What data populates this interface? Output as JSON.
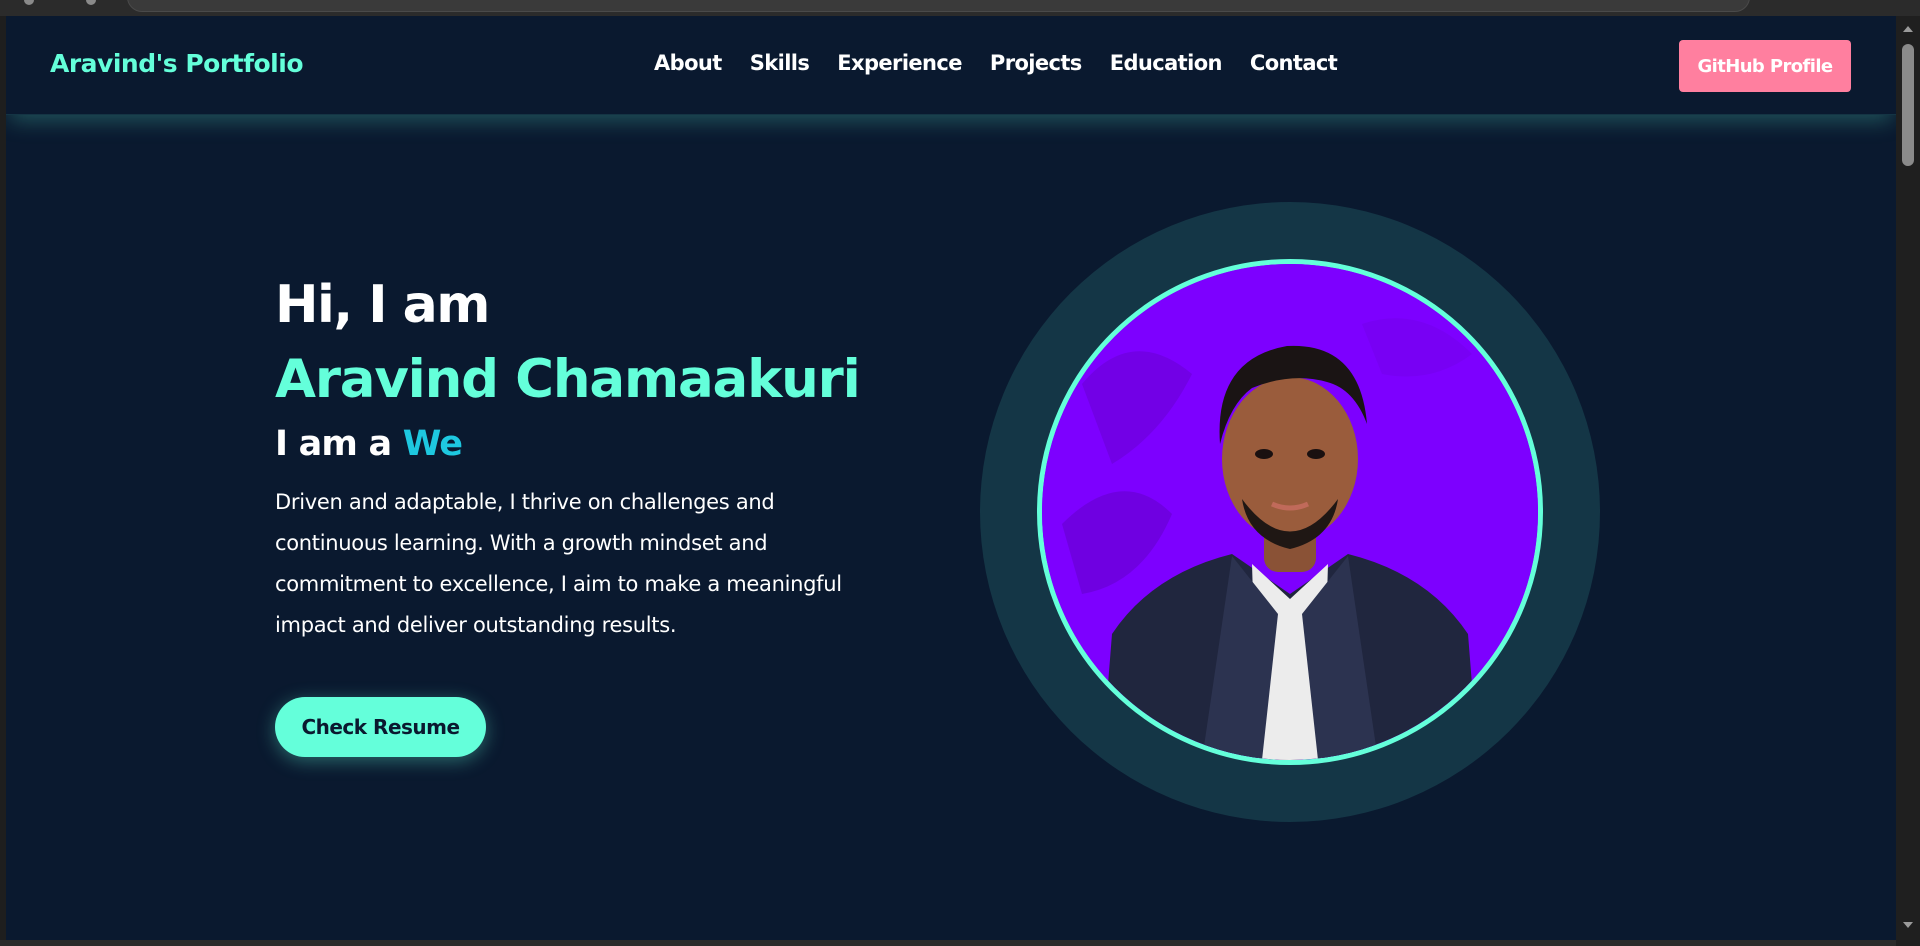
{
  "nav": {
    "logo": "Aravind's Portfolio",
    "links": [
      "About",
      "Skills",
      "Experience",
      "Projects",
      "Education",
      "Contact"
    ],
    "github_label": "GitHub Profile"
  },
  "hero": {
    "greeting": "Hi, I am",
    "name": "Aravind Chamaakuri",
    "role_prefix": "I am a",
    "role_word": "We",
    "description": "Driven and adaptable, I thrive on challenges and continuous learning. With a growth mindset and commitment to excellence, I aim to make a meaningful impact and deliver outstanding results.",
    "resume_label": "Check Resume"
  },
  "colors": {
    "background": "#0a192f",
    "accent": "#64ffda",
    "github_button": "#ff7f9f",
    "role_word": "#1ec8e0",
    "photo_background": "#7d00ff",
    "photo_halo": "#143646"
  },
  "icons": {
    "profile_photo": "profile-photo",
    "scroll_up": "chevron-up-icon",
    "scroll_down": "chevron-down-icon"
  }
}
